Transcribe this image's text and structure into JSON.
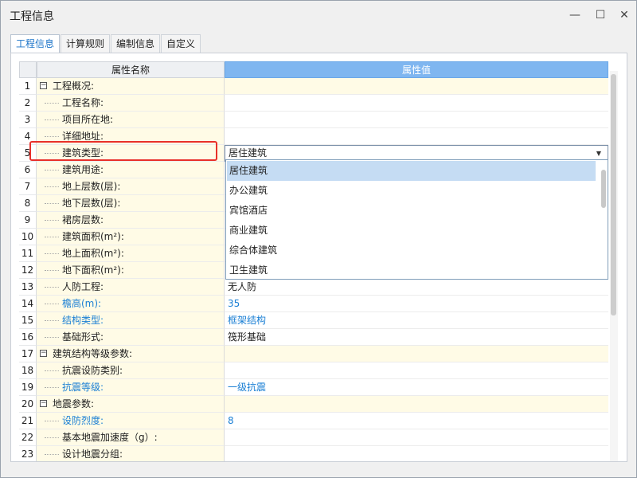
{
  "window": {
    "title": "工程信息",
    "minimize": "—",
    "maximize": "☐",
    "close": "✕"
  },
  "tabs": [
    {
      "label": "工程信息",
      "active": true
    },
    {
      "label": "计算规则",
      "active": false
    },
    {
      "label": "编制信息",
      "active": false
    },
    {
      "label": "自定义",
      "active": false
    }
  ],
  "grid": {
    "header": {
      "name": "属性名称",
      "value": "属性值"
    },
    "rows": [
      {
        "n": "1",
        "name": "工程概况:",
        "value": "",
        "group": true
      },
      {
        "n": "2",
        "name": "工程名称:",
        "value": ""
      },
      {
        "n": "3",
        "name": "项目所在地:",
        "value": ""
      },
      {
        "n": "4",
        "name": "详细地址:",
        "value": ""
      },
      {
        "n": "5",
        "name": "建筑类型:",
        "value": "居住建筑",
        "selected": true
      },
      {
        "n": "6",
        "name": "建筑用途:",
        "value": ""
      },
      {
        "n": "7",
        "name": "地上层数(层):",
        "value": ""
      },
      {
        "n": "8",
        "name": "地下层数(层):",
        "value": ""
      },
      {
        "n": "9",
        "name": "裙房层数:",
        "value": ""
      },
      {
        "n": "10",
        "name": "建筑面积(m²):",
        "value": ""
      },
      {
        "n": "11",
        "name": "地上面积(m²):",
        "value": ""
      },
      {
        "n": "12",
        "name": "地下面积(m²):",
        "value": ""
      },
      {
        "n": "13",
        "name": "人防工程:",
        "value": "无人防"
      },
      {
        "n": "14",
        "name": "檐高(m):",
        "value": "35",
        "blue": true
      },
      {
        "n": "15",
        "name": "结构类型:",
        "value": "框架结构",
        "blue": true
      },
      {
        "n": "16",
        "name": "基础形式:",
        "value": "筏形基础"
      },
      {
        "n": "17",
        "name": "建筑结构等级参数:",
        "value": "",
        "group": true
      },
      {
        "n": "18",
        "name": "抗震设防类别:",
        "value": ""
      },
      {
        "n": "19",
        "name": "抗震等级:",
        "value": "一级抗震",
        "blue": true
      },
      {
        "n": "20",
        "name": "地震参数:",
        "value": "",
        "group": true
      },
      {
        "n": "21",
        "name": "设防烈度:",
        "value": "8",
        "blue": true
      },
      {
        "n": "22",
        "name": "基本地震加速度（g）:",
        "value": ""
      },
      {
        "n": "23",
        "name": "设计地震分组:",
        "value": ""
      }
    ]
  },
  "dropdown": {
    "options": [
      "居住建筑",
      "办公建筑",
      "宾馆酒店",
      "商业建筑",
      "综合体建筑",
      "卫生建筑"
    ],
    "selected_index": 0
  },
  "colors": {
    "accent": "#1a73c8",
    "highlight": "#e8302a",
    "header_value_bg": "#7fb6f0",
    "name_bg": "#fffbe6"
  }
}
